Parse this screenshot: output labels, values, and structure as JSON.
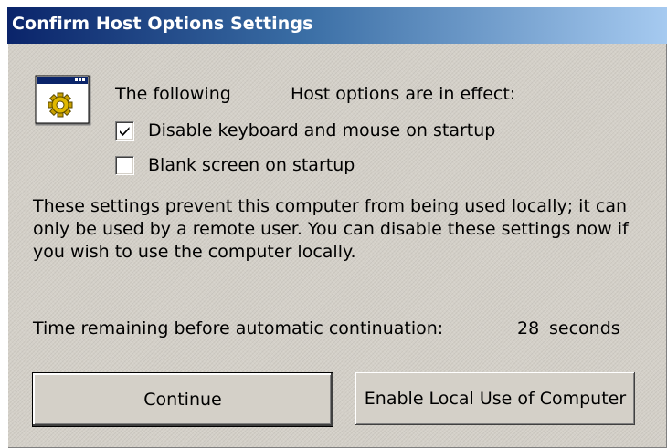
{
  "window": {
    "title": "Confirm Host Options Settings"
  },
  "icons": {
    "app": "window-gear-icon",
    "check": "checkmark-icon"
  },
  "intro": {
    "left": "The following",
    "right": "Host options are in effect:"
  },
  "options": [
    {
      "label": "Disable keyboard and mouse on startup",
      "checked": true
    },
    {
      "label": "Blank screen on startup",
      "checked": false
    }
  ],
  "message": "These settings prevent this computer from being used locally; it can only be used by a remote user.  You can disable these settings now if you wish to use the computer locally.",
  "countdown": {
    "label": "Time remaining before automatic continuation:",
    "value": "28",
    "unit": "seconds"
  },
  "buttons": {
    "continue": "Continue",
    "enable_local": "Enable Local Use of Computer"
  },
  "colors": {
    "dialog_face": "#d4d0c8",
    "titlebar_start": "#0a246a",
    "titlebar_end": "#a6caf0"
  }
}
